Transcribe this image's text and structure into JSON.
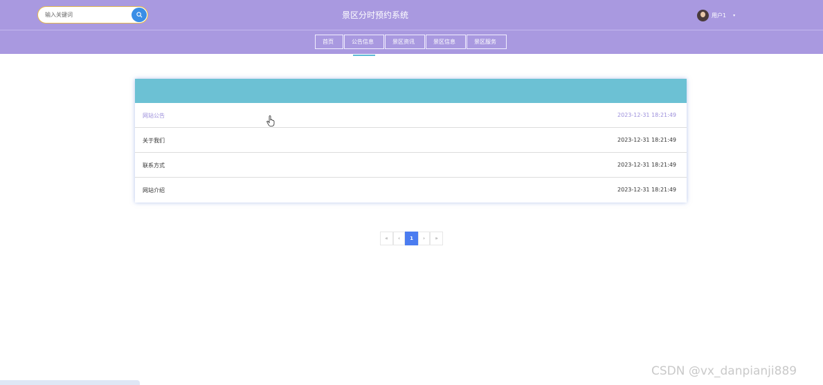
{
  "header": {
    "title": "景区分时预约系统",
    "search": {
      "placeholder": "输入关键词"
    },
    "user": {
      "name": "用户1"
    }
  },
  "nav": {
    "items": [
      {
        "label": "首页"
      },
      {
        "label": "公告信息"
      },
      {
        "label": "景区资讯"
      },
      {
        "label": "景区信息"
      },
      {
        "label": "景区服务"
      }
    ],
    "active": "公告信息"
  },
  "list": {
    "items": [
      {
        "title": "网站公告",
        "date": "2023-12-31 18:21:49"
      },
      {
        "title": "关于我们",
        "date": "2023-12-31 18:21:49"
      },
      {
        "title": "联系方式",
        "date": "2023-12-31 18:21:49"
      },
      {
        "title": "网站介绍",
        "date": "2023-12-31 18:21:49"
      }
    ]
  },
  "pagination": {
    "first": "«",
    "prev": "‹",
    "current": "1",
    "next": "›",
    "last": "»"
  },
  "watermark": "CSDN @vx_danpianji889",
  "colors": {
    "header_bg": "#a999e0",
    "card_head": "#6cc1d4",
    "accent": "#4b7cf0",
    "highlight_text": "#9c8fdb"
  }
}
